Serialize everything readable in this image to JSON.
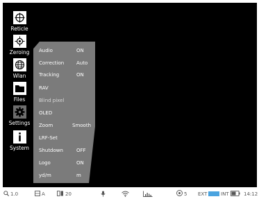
{
  "sidebar": {
    "items": [
      {
        "label": "Reticle",
        "icon": "crosshair-icon"
      },
      {
        "label": "Zeroing",
        "icon": "target-icon"
      },
      {
        "label": "Wlan",
        "icon": "globe-icon"
      },
      {
        "label": "Files",
        "icon": "folder-icon"
      },
      {
        "label": "Settings",
        "icon": "gear-icon"
      },
      {
        "label": "System",
        "icon": "info-icon"
      }
    ],
    "active": "Settings"
  },
  "menu": {
    "rows": [
      {
        "label": "Audio",
        "value": "ON"
      },
      {
        "label": "Correction",
        "value": "Auto"
      },
      {
        "label": "Tracking",
        "value": "ON"
      },
      {
        "label": "RAV",
        "value": ""
      },
      {
        "label": "Blind pixel",
        "value": ""
      },
      {
        "label": "OLED",
        "value": ""
      },
      {
        "label": "Zoom",
        "value": "Smooth"
      },
      {
        "label": "LRF-Set",
        "value": ""
      },
      {
        "label": "Shutdown",
        "value": "OFF"
      },
      {
        "label": "Logo",
        "value": "ON"
      },
      {
        "label": "yd/m",
        "value": "m"
      }
    ]
  },
  "status": {
    "zoom": "1.0",
    "mode": "A",
    "brightness": "20",
    "battery_count": "5",
    "ext_label": "EXT",
    "int_label": "INT",
    "time": "14:12"
  },
  "colors": {
    "viewport_bg": "#000000",
    "panel": "#7b7b7b",
    "ext_battery": "#4aa3df"
  }
}
